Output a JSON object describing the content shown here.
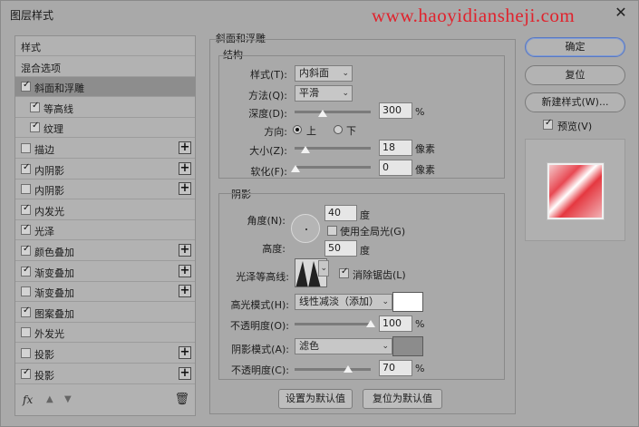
{
  "window": {
    "title": "图层样式",
    "watermark": "www.haoyidiansheji.com",
    "close_glyph": "✕"
  },
  "left_panel": {
    "items": [
      {
        "label": "样式",
        "checkbox": false,
        "checked": false,
        "plus": false,
        "selected": false,
        "indent": false
      },
      {
        "label": "混合选项",
        "checkbox": false,
        "checked": false,
        "plus": false,
        "selected": false,
        "indent": false
      },
      {
        "label": "斜面和浮雕",
        "checkbox": true,
        "checked": true,
        "plus": false,
        "selected": true,
        "indent": false
      },
      {
        "label": "等高线",
        "checkbox": true,
        "checked": true,
        "plus": false,
        "selected": false,
        "indent": true
      },
      {
        "label": "纹理",
        "checkbox": true,
        "checked": true,
        "plus": false,
        "selected": false,
        "indent": true
      },
      {
        "label": "描边",
        "checkbox": true,
        "checked": false,
        "plus": true,
        "selected": false,
        "indent": false
      },
      {
        "label": "内阴影",
        "checkbox": true,
        "checked": true,
        "plus": true,
        "selected": false,
        "indent": false
      },
      {
        "label": "内阴影",
        "checkbox": true,
        "checked": false,
        "plus": true,
        "selected": false,
        "indent": false
      },
      {
        "label": "内发光",
        "checkbox": true,
        "checked": true,
        "plus": false,
        "selected": false,
        "indent": false
      },
      {
        "label": "光泽",
        "checkbox": true,
        "checked": true,
        "plus": false,
        "selected": false,
        "indent": false
      },
      {
        "label": "颜色叠加",
        "checkbox": true,
        "checked": true,
        "plus": true,
        "selected": false,
        "indent": false
      },
      {
        "label": "渐变叠加",
        "checkbox": true,
        "checked": true,
        "plus": true,
        "selected": false,
        "indent": false
      },
      {
        "label": "渐变叠加",
        "checkbox": true,
        "checked": false,
        "plus": true,
        "selected": false,
        "indent": false
      },
      {
        "label": "图案叠加",
        "checkbox": true,
        "checked": true,
        "plus": false,
        "selected": false,
        "indent": false
      },
      {
        "label": "外发光",
        "checkbox": true,
        "checked": false,
        "plus": false,
        "selected": false,
        "indent": false
      },
      {
        "label": "投影",
        "checkbox": true,
        "checked": false,
        "plus": true,
        "selected": false,
        "indent": false
      },
      {
        "label": "投影",
        "checkbox": true,
        "checked": true,
        "plus": true,
        "selected": false,
        "indent": false
      }
    ],
    "footer": {
      "fx": "fx",
      "up": "▲",
      "down": "▼",
      "trash": "🗑"
    }
  },
  "bevel": {
    "section_title": "斜面和浮雕",
    "structure_title": "结构",
    "style_label": "样式(T):",
    "style_value": "内斜面",
    "method_label": "方法(Q):",
    "method_value": "平滑",
    "depth_label": "深度(D):",
    "depth_value": "300",
    "depth_unit": "%",
    "direction_label": "方向:",
    "direction_up": "上",
    "direction_down": "下",
    "size_label": "大小(Z):",
    "size_value": "18",
    "size_unit": "像素",
    "soften_label": "软化(F):",
    "soften_value": "0",
    "soften_unit": "像素",
    "shading_title": "阴影",
    "angle_label": "角度(N):",
    "angle_value": "40",
    "angle_unit": "度",
    "global_light_label": "使用全局光(G)",
    "altitude_label": "高度:",
    "altitude_value": "50",
    "altitude_unit": "度",
    "gloss_label": "光泽等高线:",
    "antialias_label": "消除锯齿(L)",
    "highlight_mode_label": "高光模式(H):",
    "highlight_mode_value": "线性减淡（添加）",
    "highlight_color": "#ffffff",
    "highlight_opacity_label": "不透明度(O):",
    "highlight_opacity_value": "100",
    "highlight_opacity_unit": "%",
    "shadow_mode_label": "阴影模式(A):",
    "shadow_mode_value": "滤色",
    "shadow_color": "#8c8c8c",
    "shadow_opacity_label": "不透明度(C):",
    "shadow_opacity_value": "70",
    "shadow_opacity_unit": "%",
    "make_default": "设置为默认值",
    "reset_default": "复位为默认值"
  },
  "right_panel": {
    "ok": "确定",
    "reset": "复位",
    "new_style": "新建样式(W)...",
    "preview_label": "预览(V)"
  }
}
